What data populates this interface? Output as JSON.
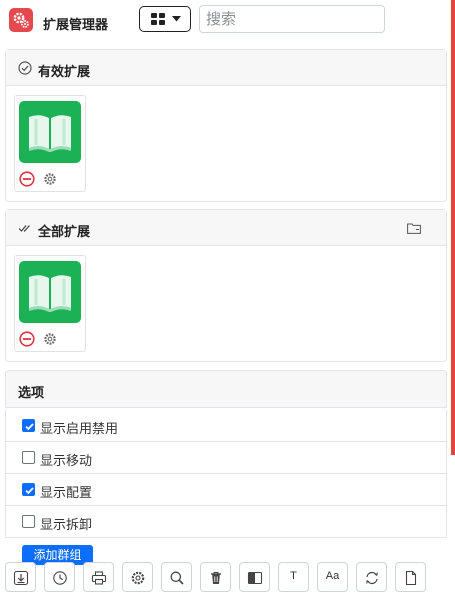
{
  "header": {
    "title": "扩展管理器",
    "view_icon": "grid-icon",
    "search_placeholder": "搜索"
  },
  "sections": [
    {
      "title": "有效扩展",
      "icon": "check-circle-icon",
      "extensions": [
        {
          "icon": "book-icon",
          "color": "#1bb256"
        }
      ]
    },
    {
      "title": "全部扩展",
      "icon": "double-check-icon",
      "extensions": [
        {
          "icon": "book-icon",
          "color": "#1bb256"
        }
      ]
    }
  ],
  "options": {
    "title": "选项",
    "items": [
      {
        "label": "显示启用禁用",
        "checked": true
      },
      {
        "label": "显示移动",
        "checked": false
      },
      {
        "label": "显示配置",
        "checked": true
      },
      {
        "label": "显示拆卸",
        "checked": false
      }
    ],
    "add_group_label": "添加群组"
  },
  "toolbar": {
    "items": [
      {
        "icon": "download-icon"
      },
      {
        "icon": "clock-icon"
      },
      {
        "icon": "printer-icon"
      },
      {
        "icon": "gear-icon"
      },
      {
        "icon": "search-icon"
      },
      {
        "icon": "trash-icon"
      },
      {
        "icon": "contrast-icon"
      },
      {
        "icon": "text-icon",
        "text": "T"
      },
      {
        "icon": "font-size-icon",
        "text": "Aa"
      },
      {
        "icon": "refresh-icon"
      },
      {
        "icon": "file-icon"
      }
    ]
  },
  "colors": {
    "accent": "#0d6efd",
    "brand": "#e5484d",
    "extension_green": "#1bb256",
    "remove_red": "#dc3545"
  }
}
